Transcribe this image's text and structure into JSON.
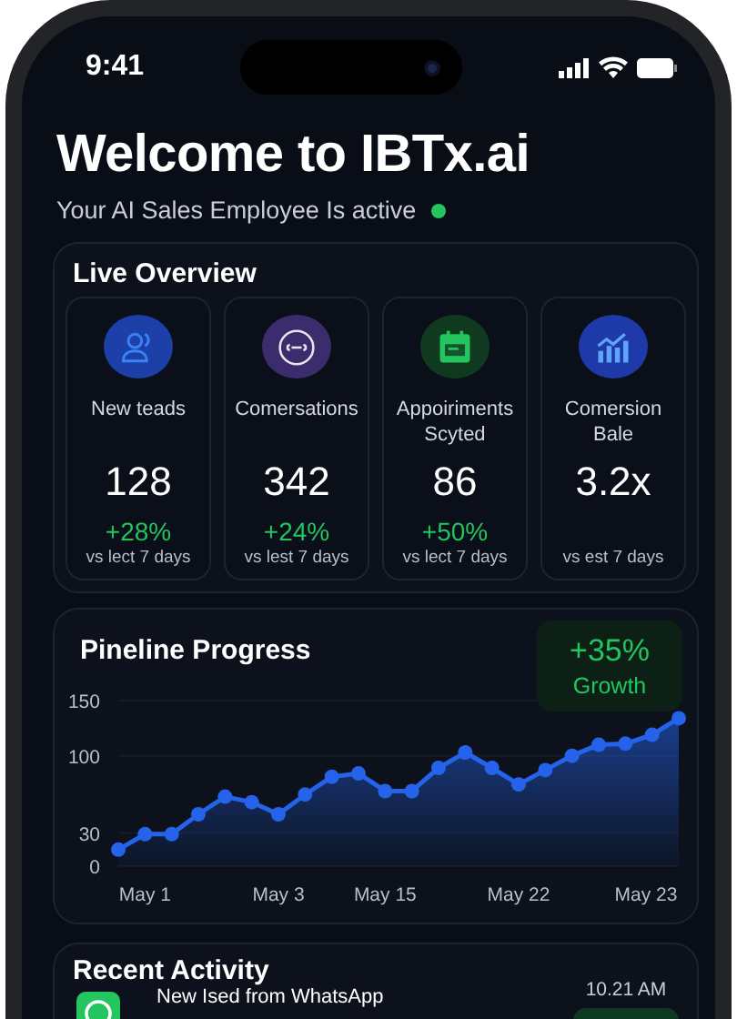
{
  "status_bar": {
    "time": "9:41"
  },
  "header": {
    "title": "Welcome to IBTx.ai",
    "subtitle": "Your AI Sales Employee Is active",
    "active": true
  },
  "live_overview": {
    "title": "Live Overview",
    "stats": [
      {
        "label": "New teads",
        "value": "128",
        "change": "+28%",
        "period": "vs lect 7 days"
      },
      {
        "label": "Comersations",
        "value": "342",
        "change": "+24%",
        "period": "vs lest 7 days"
      },
      {
        "label": "Appoiriments Scyted",
        "value": "86",
        "change": "+50%",
        "period": "vs lect 7 days"
      },
      {
        "label": "Comersion Bale",
        "value": "3.2x",
        "period": "vs  est 7 days"
      }
    ]
  },
  "pipeline": {
    "title": "Pineline Progress",
    "growth": {
      "value": "+35%",
      "label": "Growth"
    },
    "chart_data": {
      "type": "area",
      "categories": [
        null,
        "May 1",
        null,
        null,
        null,
        null,
        "May 3",
        null,
        null,
        null,
        "May 15",
        null,
        null,
        null,
        null,
        "May 22",
        null,
        null,
        null,
        null,
        "May 23",
        null
      ],
      "series": [
        {
          "color": "#2563eb",
          "values": [
            15,
            29,
            29,
            47,
            63,
            58,
            47,
            65,
            81,
            84,
            68,
            68,
            89,
            103,
            89,
            74,
            87,
            100,
            110,
            111,
            119,
            134
          ]
        }
      ],
      "ylim": [
        0,
        150
      ],
      "yticks": [
        0,
        30,
        100,
        150
      ]
    }
  },
  "recent_activity": {
    "title": "Recent Activity",
    "items": [
      {
        "title": "New Ised from WhatsApp",
        "time": "10.21 AM"
      }
    ]
  }
}
